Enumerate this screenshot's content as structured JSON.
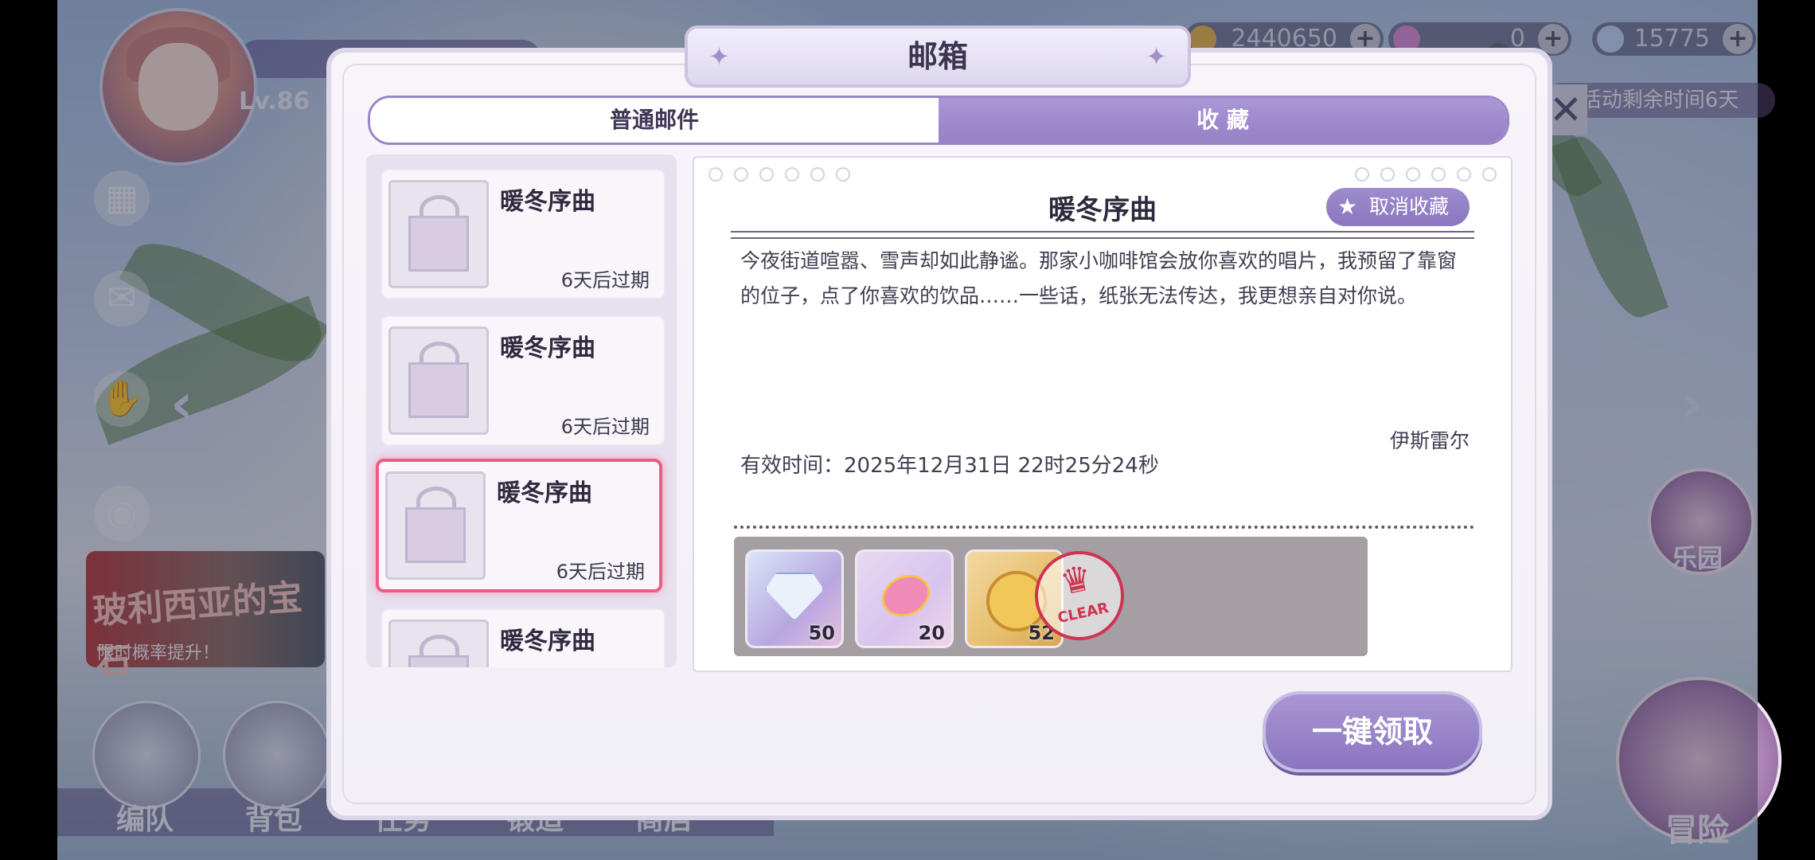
{
  "hud": {
    "level": "Lv.86",
    "currencies": [
      {
        "name": "gold-coin-icon",
        "value": "2440650",
        "color": "#e7b648"
      },
      {
        "name": "pink-gem-icon",
        "value": "0",
        "color": "#d98ad8"
      },
      {
        "name": "diamond-icon",
        "value": "15775",
        "color": "#bcd6f5"
      }
    ],
    "event_remaining": "活动剩余时间6天",
    "banner_title": "玻利西亚的宝石",
    "banner_sub": "限时概率提升！",
    "bottom_nav": [
      "编队",
      "背包",
      "任务",
      "锻造",
      "商店"
    ],
    "right_labels": {
      "park": "乐园",
      "adventure": "冒险"
    }
  },
  "modal": {
    "title": "邮箱",
    "tabs": [
      {
        "label": "普通邮件",
        "active": false
      },
      {
        "label": "收 藏",
        "active": true
      }
    ],
    "mail_list": [
      {
        "title": "暖冬序曲",
        "expire": "6天后过期",
        "selected": false
      },
      {
        "title": "暖冬序曲",
        "expire": "6天后过期",
        "selected": false
      },
      {
        "title": "暖冬序曲",
        "expire": "6天后过期",
        "selected": true
      },
      {
        "title": "暖冬序曲",
        "expire": "",
        "selected": false
      }
    ],
    "detail": {
      "title": "暖冬序曲",
      "unfavorite_label": "取消收藏",
      "body": "今夜街道喧嚣、雪声却如此静谧。那家小咖啡馆会放你喜欢的唱片，我预留了靠窗的位子，点了你喜欢的饮品……一些话，纸张无法传达，我更想亲自对你说。",
      "sender": "伊斯雷尔",
      "valid_time": "有效时间：2025年12月31日   22时25分24秒",
      "rewards": [
        {
          "icon": "diamond-icon",
          "count": "50"
        },
        {
          "icon": "candy-icon",
          "count": "20"
        },
        {
          "icon": "gold-coin-icon",
          "count": "52"
        }
      ],
      "claimed_stamp": "CLEAR"
    },
    "claim_all_label": "一键领取"
  }
}
